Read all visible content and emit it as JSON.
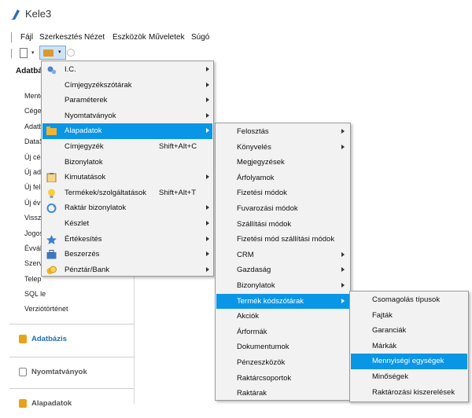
{
  "app": {
    "title": "Kele3"
  },
  "menubar": [
    "Fájl",
    "Szerkesztés",
    "Nézet",
    "Eszközök",
    "Műveletek",
    "Súgó"
  ],
  "left_panel": {
    "title": "Adatbá",
    "items": [
      "Mente",
      "Cégel",
      "Adatb",
      "DataS",
      "Új cég",
      "Új ada",
      "Új fel",
      "Új év",
      "Vissz",
      "Jogos",
      "Évvál",
      "Szerv",
      "Telep",
      "SQL le",
      "Verziótörténet"
    ],
    "bottom": [
      {
        "label": "Adatbázis",
        "color": "#1e6fb8"
      },
      {
        "label": "Nyomtatványok",
        "color": "#555555"
      },
      {
        "label": "Alapadatok",
        "color": "#555555"
      }
    ]
  },
  "menu_main": [
    {
      "label": "I.C.",
      "shortcut": "",
      "submenu": true,
      "icon": "gears-icon"
    },
    {
      "label": "Címjegyzékszótárak",
      "shortcut": "",
      "submenu": true,
      "icon": ""
    },
    {
      "label": "Paraméterek",
      "shortcut": "",
      "submenu": true,
      "icon": ""
    },
    {
      "label": "Nyomtatványok",
      "shortcut": "",
      "submenu": true,
      "icon": ""
    },
    {
      "label": "Alapadatok",
      "shortcut": "",
      "submenu": true,
      "icon": "folder-icon",
      "highlighted": true
    },
    {
      "label": "Címjegyzék",
      "shortcut": "Shift+Alt+C",
      "submenu": false,
      "icon": ""
    },
    {
      "label": "Bizonylatok",
      "shortcut": "",
      "submenu": false,
      "icon": ""
    },
    {
      "label": "Kimutatások",
      "shortcut": "",
      "submenu": true,
      "icon": "clipboard-icon"
    },
    {
      "label": "Termékek/szolgáltatások",
      "shortcut": "Shift+Alt+T",
      "submenu": false,
      "icon": "bulb-icon"
    },
    {
      "label": "Raktár bizonylatok",
      "shortcut": "",
      "submenu": true,
      "icon": "refresh-icon"
    },
    {
      "label": "Készlet",
      "shortcut": "",
      "submenu": true,
      "icon": ""
    },
    {
      "label": "Értékesítés",
      "shortcut": "",
      "submenu": true,
      "icon": "star-icon"
    },
    {
      "label": "Beszerzés",
      "shortcut": "",
      "submenu": true,
      "icon": "briefcase-icon"
    },
    {
      "label": "Pénztár/Bank",
      "shortcut": "",
      "submenu": true,
      "icon": "coins-icon"
    }
  ],
  "menu_alapadatok": [
    {
      "label": "Felosztás",
      "submenu": true
    },
    {
      "label": "Könyvelés",
      "submenu": true
    },
    {
      "label": "Megjegyzések",
      "submenu": false
    },
    {
      "label": "Árfolyamok",
      "submenu": false
    },
    {
      "label": "Fizetési módok",
      "submenu": false
    },
    {
      "label": "Fuvarozási módok",
      "submenu": false
    },
    {
      "label": "Szállítási módok",
      "submenu": false
    },
    {
      "label": "Fizetési mód szállítási módok",
      "submenu": false
    },
    {
      "label": "CRM",
      "submenu": true
    },
    {
      "label": "Gazdaság",
      "submenu": true
    },
    {
      "label": "Bizonylatok",
      "submenu": true
    },
    {
      "label": "Termék kódszótárak",
      "submenu": true,
      "highlighted": true
    },
    {
      "label": "Akciók",
      "submenu": false
    },
    {
      "label": "Árformák",
      "submenu": false
    },
    {
      "label": "Dokumentumok",
      "submenu": false
    },
    {
      "label": "Pénzeszközök",
      "submenu": false
    },
    {
      "label": "Raktárcsoportok",
      "submenu": false
    },
    {
      "label": "Raktárak",
      "submenu": false
    }
  ],
  "menu_termek": [
    {
      "label": "Csomagolás típusok"
    },
    {
      "label": "Fajták"
    },
    {
      "label": "Garanciák"
    },
    {
      "label": "Márkák"
    },
    {
      "label": "Mennyiségi egységek",
      "highlighted": true
    },
    {
      "label": "Minőségek"
    },
    {
      "label": "Raktározási kiszerelések"
    }
  ],
  "colors": {
    "highlight": "#0a96e6",
    "menu_bg": "#f2f2f2"
  }
}
